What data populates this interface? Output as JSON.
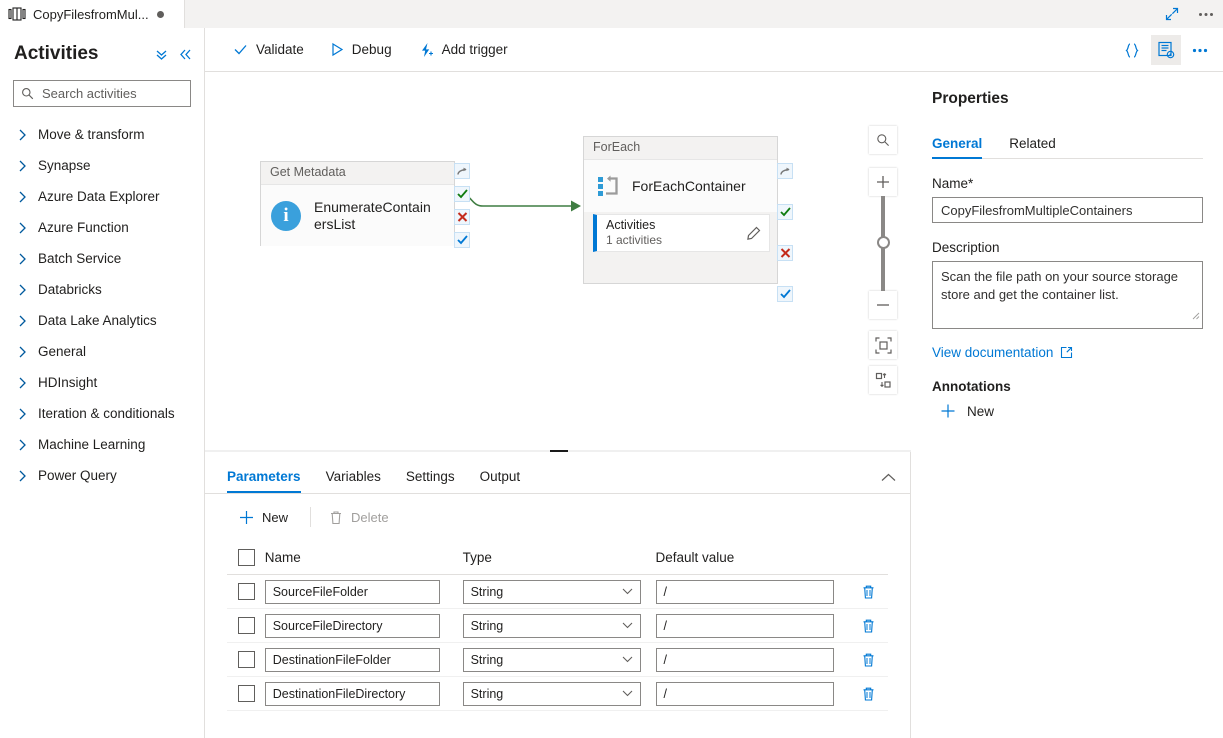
{
  "tab": {
    "title": "CopyFilesfromMul...",
    "icon": "pipeline-icon",
    "dirty_indicator": "●"
  },
  "tabstrip_right": {
    "expand_icon": "expand-icon",
    "more_icon": "more-icon"
  },
  "sidebar": {
    "title": "Activities",
    "collapse_all_icon": "double-chevron-down-icon",
    "collapse_panel_icon": "double-chevron-left-icon",
    "search": {
      "placeholder": "Search activities",
      "value": "",
      "icon": "search-icon"
    },
    "items": [
      {
        "label": "Move & transform"
      },
      {
        "label": "Synapse"
      },
      {
        "label": "Azure Data Explorer"
      },
      {
        "label": "Azure Function"
      },
      {
        "label": "Batch Service"
      },
      {
        "label": "Databricks"
      },
      {
        "label": "Data Lake Analytics"
      },
      {
        "label": "General"
      },
      {
        "label": "HDInsight"
      },
      {
        "label": "Iteration & conditionals"
      },
      {
        "label": "Machine Learning"
      },
      {
        "label": "Power Query"
      }
    ]
  },
  "toolbar": {
    "validate": "Validate",
    "debug": "Debug",
    "add_trigger": "Add trigger",
    "code_icon": "code-braces-icon",
    "properties_icon": "properties-panel-icon",
    "more_icon": "more-icon"
  },
  "canvas": {
    "nodes": [
      {
        "type_label": "Get Metadata",
        "name": "EnumerateContainersList",
        "icon": "get-metadata-info-icon",
        "handles": [
          "skip-handle",
          "success-handle",
          "failure-handle",
          "completion-handle"
        ]
      },
      {
        "type_label": "ForEach",
        "name": "ForEachContainer",
        "icon": "foreach-loop-icon",
        "activities_label": "Activities",
        "activities_count": "1 activities",
        "edit_icon": "pencil-icon",
        "handles": [
          "skip-handle",
          "success-handle",
          "failure-handle",
          "completion-handle"
        ]
      }
    ],
    "connector": {
      "type": "success",
      "color": "#107c10"
    },
    "zoom_controls": {
      "search_icon": "search-canvas-icon",
      "zoom_in": "+",
      "zoom_out": "−",
      "fit_icon": "fit-to-screen-icon",
      "align_icon": "auto-align-icon"
    }
  },
  "bottom_panel": {
    "tabs": [
      {
        "label": "Parameters",
        "active": true
      },
      {
        "label": "Variables",
        "active": false
      },
      {
        "label": "Settings",
        "active": false
      },
      {
        "label": "Output",
        "active": false
      }
    ],
    "collapse_icon": "chevron-up-icon",
    "commands": {
      "new": {
        "label": "New",
        "icon": "plus-icon",
        "disabled": false
      },
      "delete": {
        "label": "Delete",
        "icon": "trash-icon",
        "disabled": true
      }
    },
    "table": {
      "headers": [
        "Name",
        "Type",
        "Default value"
      ],
      "rows": [
        {
          "name": "SourceFileFolder",
          "type": "String",
          "default": "/"
        },
        {
          "name": "SourceFileDirectory",
          "type": "String",
          "default": "/"
        },
        {
          "name": "DestinationFileFolder",
          "type": "String",
          "default": "/"
        },
        {
          "name": "DestinationFileDirectory",
          "type": "String",
          "default": "/"
        }
      ],
      "delete_row_icon": "trash-icon"
    }
  },
  "properties": {
    "title": "Properties",
    "tabs": [
      {
        "label": "General",
        "active": true
      },
      {
        "label": "Related",
        "active": false
      }
    ],
    "name_label": "Name",
    "name_required": "*",
    "name_value": "CopyFilesfromMultipleContainers",
    "description_label": "Description",
    "description_value": "Scan the file path on your source storage store and get the container list.",
    "doc_link": "View documentation",
    "doc_link_icon": "external-link-icon",
    "annotations_label": "Annotations",
    "annotation_new": "New",
    "annotation_new_icon": "plus-icon"
  },
  "colors": {
    "accent": "#0078d4",
    "success": "#107c10",
    "failure": "#c42b1c",
    "info": "#3aa0dc"
  }
}
